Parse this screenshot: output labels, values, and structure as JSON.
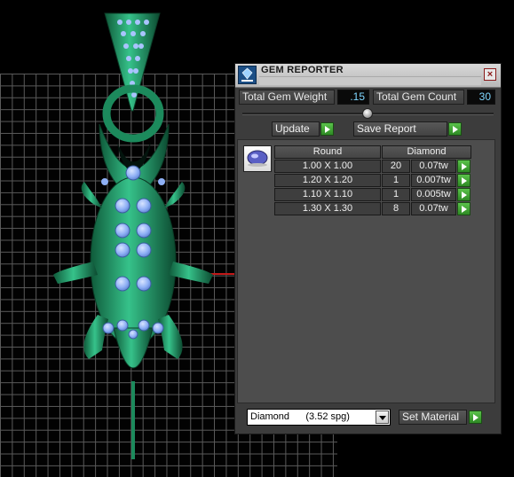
{
  "panel": {
    "title": "GEM REPORTER",
    "close_glyph": "×",
    "total_weight_label": "Total Gem Weight",
    "total_weight_value": ".15",
    "total_count_label": "Total Gem Count",
    "total_count_value": "30",
    "update_label": "Update",
    "save_report_label": "Save Report",
    "set_material_label": "Set Material",
    "material_value": "Diamond      (3.52 spg)"
  },
  "report": {
    "shape_header": "Round",
    "material_header": "Diamond",
    "rows": [
      {
        "size": "1.00 X 1.00",
        "count": "20",
        "weight": "0.07tw"
      },
      {
        "size": "1.20 X 1.20",
        "count": "1",
        "weight": "0.007tw"
      },
      {
        "size": "1.10 X 1.10",
        "count": "1",
        "weight": "0.005tw"
      },
      {
        "size": "1.30 X 1.30",
        "count": "8",
        "weight": "0.07tw"
      }
    ]
  },
  "icons": {
    "app": "gem-reporter-app-icon",
    "close": "close-icon",
    "play": "play-arrow-icon",
    "dropdown": "chevron-down-icon",
    "gem": "round-gem-icon"
  },
  "colors": {
    "model_green": "#1f9a68",
    "gem_blue": "#8fb0f5",
    "value_text": "#7fd7ff",
    "play_green": "#3aa82e"
  }
}
